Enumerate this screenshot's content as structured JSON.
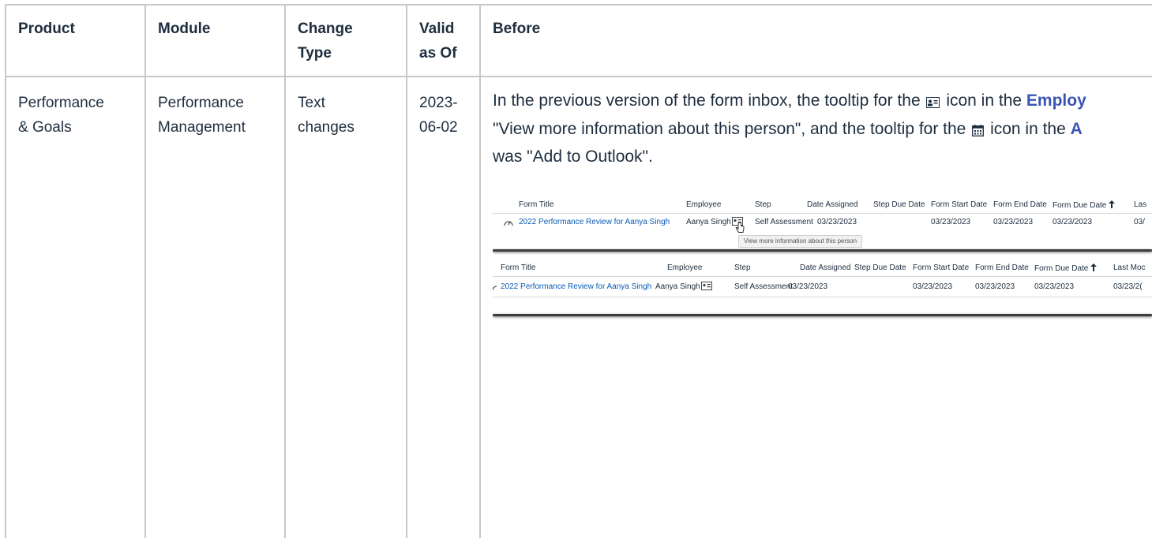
{
  "headers": {
    "product": "Product",
    "module": "Module",
    "change_type_1": "Change",
    "change_type_2": "Type",
    "valid_1": "Valid",
    "valid_2": "as Of",
    "before": "Before"
  },
  "row": {
    "product_1": "Performance",
    "product_2": "& Goals",
    "module_1": "Performance",
    "module_2": "Management",
    "change_1": "Text",
    "change_2": "changes",
    "valid_1": "2023-",
    "valid_2": "06-02"
  },
  "before_text": {
    "l1_a": "In the previous version of the form inbox, the tooltip for the",
    "l1_b": "icon in the",
    "l1_link": "Employ",
    "l2_a": "\"View more information about this person\", and the tooltip for the",
    "l2_b": "icon in the",
    "l2_link": "A",
    "l3": "was \"Add to Outlook\"."
  },
  "screenshot1": {
    "headers": [
      "Form Title",
      "Employee",
      "Step",
      "Date Assigned",
      "Step Due Date",
      "Form Start Date",
      "Form End Date",
      "Form Due Date",
      "Las"
    ],
    "row": {
      "title": "2022 Performance Review for Aanya Singh",
      "employee": "Aanya Singh",
      "step": "Self Assessment",
      "date_assigned": "03/23/2023",
      "start": "03/23/2023",
      "end": "03/23/2023",
      "due": "03/23/2023",
      "last": "03/"
    },
    "tooltip": "View more information about this person"
  },
  "screenshot2": {
    "headers": [
      "Form Title",
      "Employee",
      "Step",
      "Date Assigned",
      "Step Due Date",
      "Form Start Date",
      "Form End Date",
      "Form Due Date",
      "Last Moc"
    ],
    "row": {
      "title": "2022 Performance Review for Aanya Singh",
      "employee": "Aanya Singh",
      "step": "Self Assessment",
      "date_assigned": "03/23/2023",
      "start": "03/23/2023",
      "end": "03/23/2023",
      "due": "03/23/2023",
      "last": "03/23/2("
    }
  },
  "icons": [
    "contact-card-icon",
    "calendar-icon",
    "gauge-icon",
    "sort-ascending-icon",
    "hand-cursor-icon"
  ]
}
